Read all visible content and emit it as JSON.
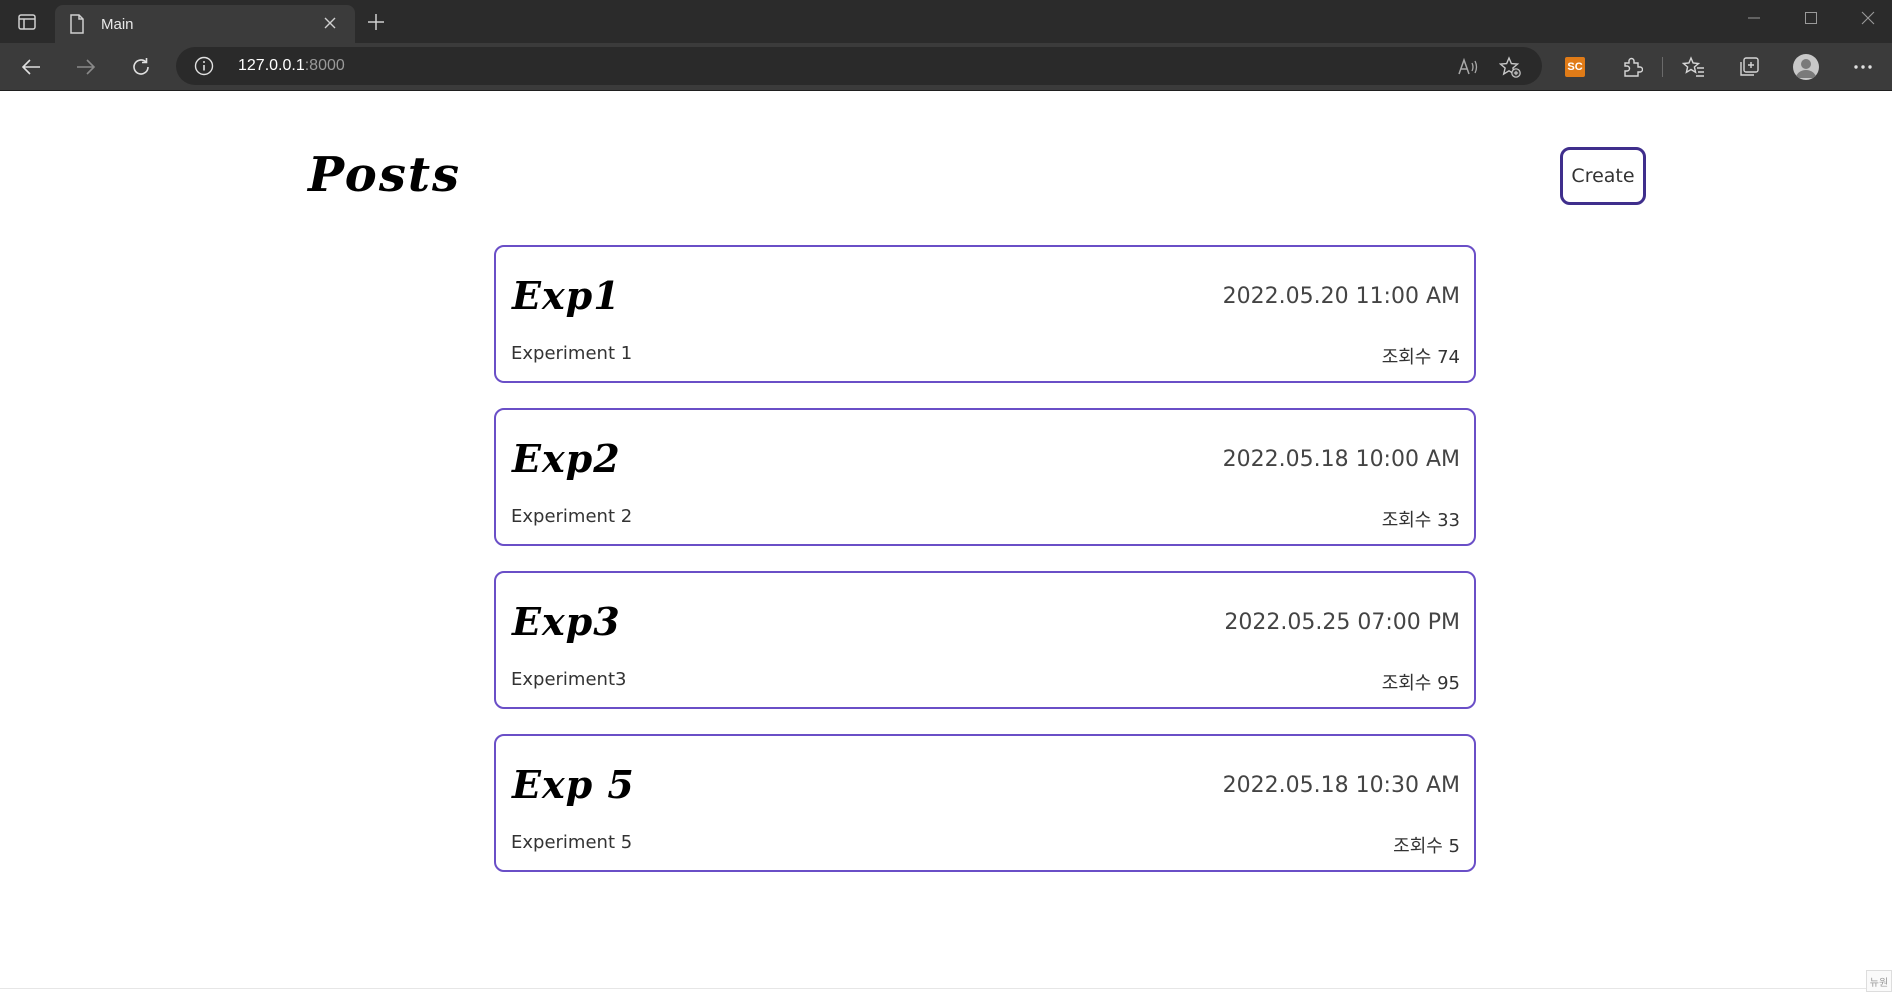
{
  "browser": {
    "tab_title": "Main",
    "url_host": "127.0.0.1",
    "url_port": ":8000"
  },
  "extensions": {
    "sc_label": "SC"
  },
  "page": {
    "title": "Posts",
    "create_label": "Create",
    "corner_badge": "뉴원"
  },
  "posts": [
    {
      "title": "Exp1",
      "date": "2022.05.20 11:00 AM",
      "description": "Experiment 1",
      "views_label": "조회수 74"
    },
    {
      "title": "Exp2",
      "date": "2022.05.18 10:00 AM",
      "description": "Experiment 2",
      "views_label": "조회수 33"
    },
    {
      "title": "Exp3",
      "date": "2022.05.25 07:00 PM",
      "description": "Experiment3",
      "views_label": "조회수 95"
    },
    {
      "title": "Exp 5",
      "date": "2022.05.18 10:30 AM",
      "description": "Experiment 5",
      "views_label": "조회수 5"
    }
  ],
  "colors": {
    "card_border": "#6a4fc7",
    "create_border": "#3f2e8c",
    "chrome_dark": "#2b2b2b",
    "chrome_toolbar": "#3b3b3b"
  }
}
